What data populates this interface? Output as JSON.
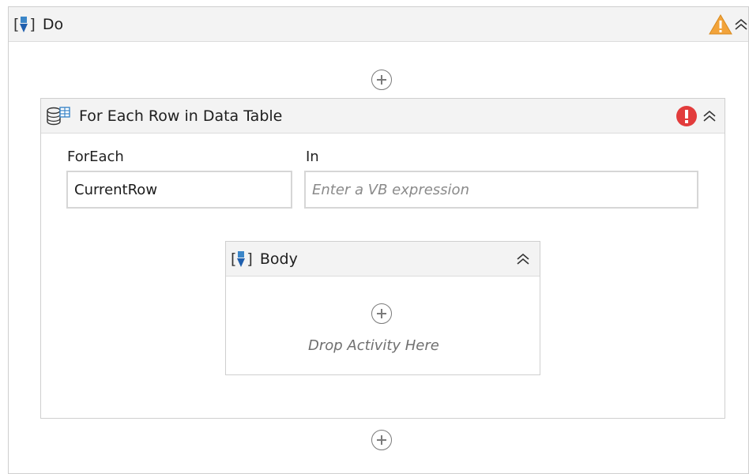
{
  "do_sequence": {
    "title": "Do",
    "warning_icon": "warning-icon",
    "collapse_icon": "collapse-chevrons-icon"
  },
  "foreach_activity": {
    "title": "For Each Row in Data Table",
    "error_icon": "error-icon",
    "foreach_label": "ForEach",
    "foreach_value": "CurrentRow",
    "in_label": "In",
    "in_placeholder": "Enter a VB expression"
  },
  "body_sequence": {
    "title": "Body",
    "drop_text": "Drop Activity Here"
  },
  "colors": {
    "accent": "#3b86c8",
    "warning": "#f2a33a",
    "error": "#e23c3c",
    "border": "#cfcfcf"
  }
}
